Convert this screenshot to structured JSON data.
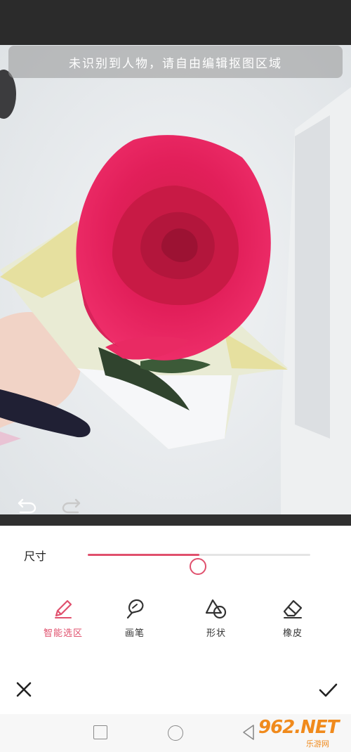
{
  "toast": {
    "message": "未识别到人物，请自由编辑抠图区域"
  },
  "editor": {
    "size_label": "尺寸",
    "size_value": 0.5
  },
  "tools": [
    {
      "label": "智能选区",
      "icon": "pen-icon",
      "active": true
    },
    {
      "label": "画笔",
      "icon": "brush-icon",
      "active": false
    },
    {
      "label": "形状",
      "icon": "shapes-icon",
      "active": false
    },
    {
      "label": "橡皮",
      "icon": "eraser-icon",
      "active": false
    }
  ],
  "actions": {
    "cancel_icon": "close-icon",
    "confirm_icon": "check-icon"
  },
  "system_nav": [
    "recent-apps",
    "home",
    "back"
  ],
  "watermark": {
    "brand": "962.NET",
    "sub": "乐游网"
  },
  "colors": {
    "accent": "#e0506d",
    "dark_bar": "#2b2b2b"
  }
}
